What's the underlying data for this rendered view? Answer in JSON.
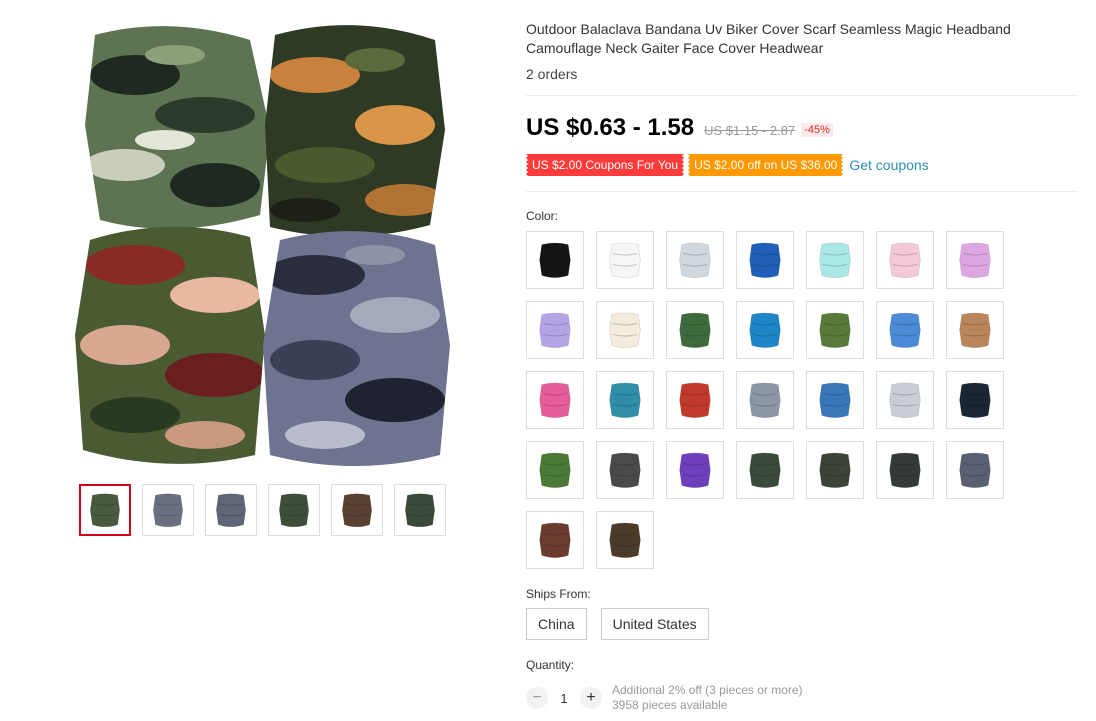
{
  "product": {
    "title": "Outdoor Balaclava Bandana Uv Biker Cover Scarf Seamless Magic Headband Camouflage Neck Gaiter Face Cover Headwear",
    "orders": "2 orders",
    "price": "US $0.63 - 1.58",
    "old_price": "US $1.15 - 2.87",
    "discount": "-45%"
  },
  "coupons": {
    "first": "US $2.00 Coupons For You",
    "second": "US $2.00 off on US $36.00",
    "link": "Get coupons"
  },
  "color": {
    "label": "Color:",
    "swatches": [
      {
        "name": "black",
        "color": "#141414"
      },
      {
        "name": "white",
        "color": "#f6f6f6"
      },
      {
        "name": "light-gray",
        "color": "#cfd8de"
      },
      {
        "name": "blue",
        "color": "#1f5fb8"
      },
      {
        "name": "light-cyan",
        "color": "#a9e8e6"
      },
      {
        "name": "pink",
        "color": "#f4c9d6"
      },
      {
        "name": "light-purple",
        "color": "#dca6e3"
      },
      {
        "name": "lavender",
        "color": "#b4a4e6"
      },
      {
        "name": "beige",
        "color": "#f3ecdc"
      },
      {
        "name": "green-camo",
        "color": "#3e6b3e"
      },
      {
        "name": "blue-camo",
        "color": "#1e86c8"
      },
      {
        "name": "forest-camo",
        "color": "#5a7a3a"
      },
      {
        "name": "sky-camo",
        "color": "#4b8ad6"
      },
      {
        "name": "desert-camo",
        "color": "#b9855a"
      },
      {
        "name": "pink-camo",
        "color": "#e65d9a"
      },
      {
        "name": "teal-camo",
        "color": "#2f8ea8"
      },
      {
        "name": "red-camo",
        "color": "#c0392b"
      },
      {
        "name": "gray-camo",
        "color": "#8d96a4"
      },
      {
        "name": "blue-pattern",
        "color": "#3a77b8"
      },
      {
        "name": "snow-camo",
        "color": "#c9ced6"
      },
      {
        "name": "navy",
        "color": "#1a2633"
      },
      {
        "name": "olive",
        "color": "#4a7a35"
      },
      {
        "name": "dark-gray",
        "color": "#4a4a4a"
      },
      {
        "name": "purple",
        "color": "#6e3fbd"
      },
      {
        "name": "dark-camo-1",
        "color": "#3a4a3a"
      },
      {
        "name": "dark-camo-2",
        "color": "#3c4438"
      },
      {
        "name": "dark-camo-3",
        "color": "#333a38"
      },
      {
        "name": "gray-blue-camo",
        "color": "#5a5f73"
      },
      {
        "name": "red-brown-camo",
        "color": "#6b3b2e"
      },
      {
        "name": "brown-camo",
        "color": "#4a3a28"
      }
    ]
  },
  "ships": {
    "label": "Ships From:",
    "options": [
      "China",
      "United States"
    ]
  },
  "quantity": {
    "label": "Quantity:",
    "value": "1",
    "minus": "−",
    "plus": "+",
    "note1": "Additional 2% off (3 pieces or more)",
    "note2": "3958 pieces available"
  },
  "gallery": {
    "thumbs": [
      {
        "name": "thumb-four-camo",
        "color": "#4a5a3e"
      },
      {
        "name": "thumb-gray-camo",
        "color": "#6a6f80"
      },
      {
        "name": "thumb-blue-gray",
        "color": "#5e6677"
      },
      {
        "name": "thumb-green-camo",
        "color": "#3e4e3a"
      },
      {
        "name": "thumb-brown-camo",
        "color": "#5a4030"
      },
      {
        "name": "thumb-woodland",
        "color": "#3a4a3a"
      }
    ]
  }
}
